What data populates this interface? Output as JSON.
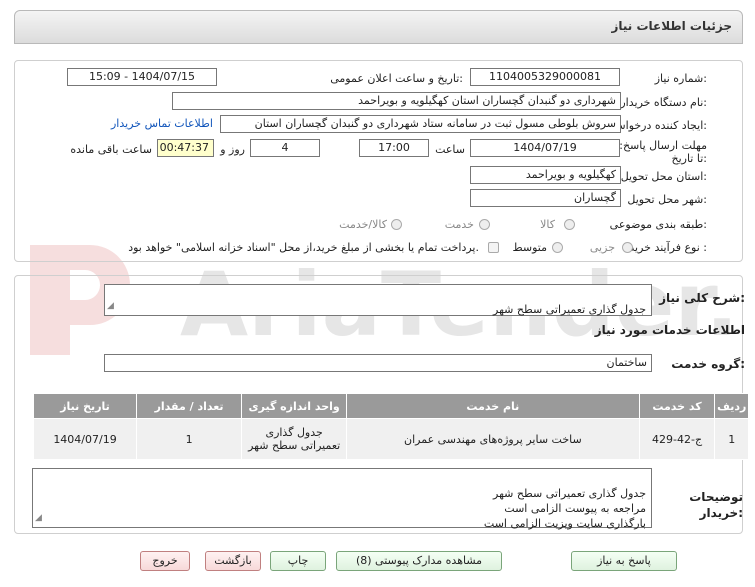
{
  "title": "جزئیات اطلاعات نیاز",
  "fields": {
    "need_number_label": "شماره نیاز:",
    "need_number": "1104005329000081",
    "announce_label": "تاریخ و ساعت اعلان عمومی:",
    "announce_value": "1404/07/15 - 15:09",
    "buyer_org_label": "نام دستگاه خریدار:",
    "buyer_org": "شهرداری دو گنبدان گچساران استان کهگیلویه و بویراحمد",
    "creator_label": "ایجاد کننده درخواست:",
    "creator": "سروش بلوطی مسول ثبت در سامانه ستاد شهرداری دو گنبدان گچساران استان",
    "contact_link": "اطلاعات تماس خریدار",
    "deadline_label": "مهلت ارسال پاسخ: تا تاریخ:",
    "deadline_date": "1404/07/19",
    "time_label": "ساعت",
    "deadline_time": "17:00",
    "days_value": "4",
    "days_label": "روز و",
    "remaining_time": "00:47:37",
    "remaining_label": "ساعت باقی مانده",
    "province_label": "استان محل تحویل:",
    "province": "کهگیلویه و بویراحمد",
    "city_label": "شهر محل تحویل:",
    "city": "گچساران",
    "category_label": "طبقه بندی موضوعی:",
    "category_options": [
      "کالا",
      "خدمت",
      "کالا/خدمت"
    ],
    "purchase_type_label": "نوع فرآیند خرید :",
    "purchase_type_options": [
      "جزیی",
      "متوسط"
    ],
    "treasury_note": "پرداخت تمام یا بخشی از مبلغ خرید،از محل \"اسناد خزانه اسلامی\" خواهد بود."
  },
  "summary": {
    "label": "شرح کلی نیاز:",
    "value": "جدول گذاری تعمیراتی سطح شهر"
  },
  "services": {
    "section_title": "اطلاعات خدمات مورد نیاز",
    "group_label": "گروه خدمت:",
    "group_value": "ساختمان",
    "columns": [
      "ردیف",
      "کد خدمت",
      "نام خدمت",
      "واحد اندازه گیری",
      "تعداد / مقدار",
      "تاریخ نیاز"
    ],
    "rows": [
      {
        "row": "1",
        "code": "ج-42-429",
        "name": "ساخت سایر پروژه‌های مهندسی عمران",
        "unit": "جدول گذاری تعمیراتی سطح شهر",
        "qty": "1",
        "date": "1404/07/19"
      }
    ]
  },
  "buyer_notes": {
    "label": "توضیحات خریدار:",
    "value": "جدول گذاری تعمیراتی سطح شهر\nمراجعه به پیوست الزامی است\nبارگذاری سایت ویزیت الزامی است"
  },
  "buttons": {
    "reply": "پاسخ به نیاز",
    "attachments": "مشاهده مدارک پیوستی (8)",
    "print": "چاپ",
    "back": "بازگشت",
    "exit": "خروج"
  },
  "watermark": "AriaTender.net",
  "colors": {
    "link": "#1155bb",
    "header_gray": "#9a9a9a",
    "highlight": "#ffffcc"
  }
}
